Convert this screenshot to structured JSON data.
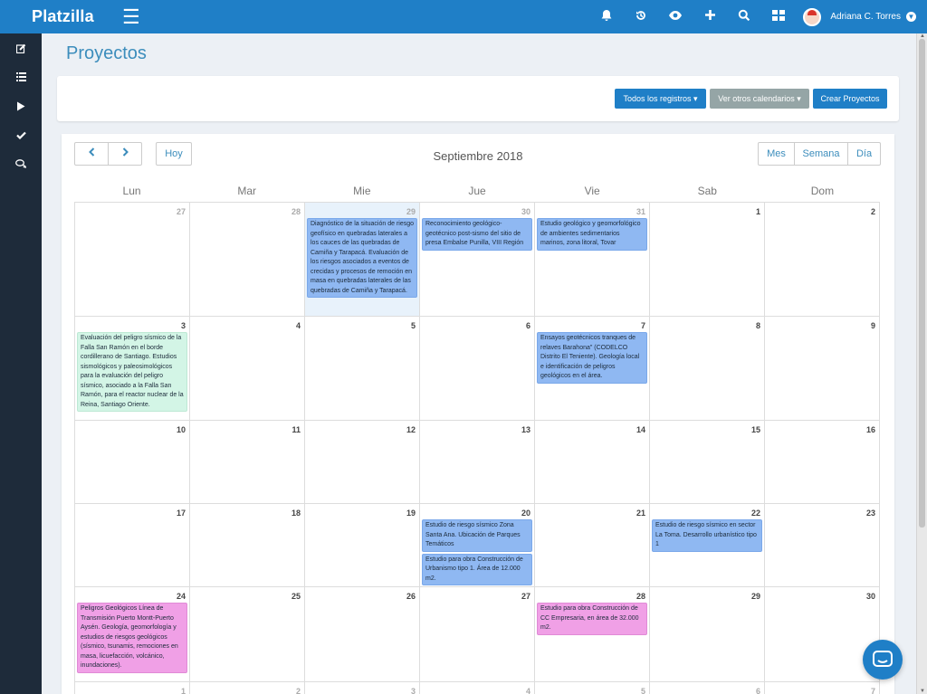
{
  "app": {
    "brand": "Platzilla"
  },
  "topbar": {
    "icons": [
      "bell-icon",
      "history-icon",
      "eye-icon",
      "plus-icon",
      "search-icon",
      "grid-icon"
    ],
    "user_name": "Adriana C. Torres"
  },
  "sidebar": {
    "items": [
      "edit-icon",
      "list-icon",
      "play-icon",
      "check-icon",
      "chat-icon"
    ]
  },
  "page": {
    "title": "Proyectos"
  },
  "toolbar": {
    "all_records": "Todos los registros ▾",
    "other_calendars": "Ver otros calendarios ▾",
    "create": "Crear Proyectos"
  },
  "colors": {
    "primary": "#1f7fc7",
    "sidebar": "#1e2b3a",
    "event_blue": "#8fb8f2",
    "event_green": "#d3f5e6",
    "event_pink": "#f0a0e6"
  },
  "calendar": {
    "title": "Septiembre 2018",
    "prev": "‹",
    "next": "›",
    "today_btn": "Hoy",
    "views": [
      "Mes",
      "Semana",
      "Día"
    ],
    "weekdays": [
      "Lun",
      "Mar",
      "Mie",
      "Jue",
      "Vie",
      "Sab",
      "Dom"
    ],
    "weeks": [
      [
        {
          "day": "27",
          "other": true,
          "events": []
        },
        {
          "day": "28",
          "other": true,
          "events": []
        },
        {
          "day": "29",
          "other": true,
          "today": true,
          "events": [
            {
              "color": "blue",
              "text": "Diagnóstico de la situación de riesgo geofísico en quebradas laterales a los cauces de las quebradas de Camiña y Tarapacá. Evaluación de los riesgos asociados a eventos de crecidas y procesos de remoción en masa en quebradas laterales de las quebradas de Camiña y Tarapacá."
            }
          ]
        },
        {
          "day": "30",
          "other": true,
          "events": [
            {
              "color": "blue",
              "text": "Reconocimiento geológico-geotécnico post-sismo del sitio de presa Embalse Punilla, VIII Región"
            }
          ]
        },
        {
          "day": "31",
          "other": true,
          "events": [
            {
              "color": "blue",
              "text": "Estudio geológico y geomorfológico de ambientes sedimentarios marinos, zona litoral, Tovar"
            }
          ]
        },
        {
          "day": "1",
          "events": []
        },
        {
          "day": "2",
          "events": []
        }
      ],
      [
        {
          "day": "3",
          "events": [
            {
              "color": "green",
              "text": "Evaluación del peligro sísmico de la Falla San Ramón en el borde cordillerano de Santiago. Estudios sismológicos y paleosimológicos para la evaluación del peligro sísmico, asociado a la Falla San Ramón, para el reactor nuclear de la Reina, Santiago Oriente."
            }
          ]
        },
        {
          "day": "4",
          "events": []
        },
        {
          "day": "5",
          "events": []
        },
        {
          "day": "6",
          "events": []
        },
        {
          "day": "7",
          "events": [
            {
              "color": "blue",
              "text": "Ensayos geotécnicos tranques de relaves Barahona\" (CODELCO Distrito El Teniente). Geología local e identificación de peligros geológicos en el área."
            }
          ]
        },
        {
          "day": "8",
          "events": []
        },
        {
          "day": "9",
          "events": []
        }
      ],
      [
        {
          "day": "10",
          "events": []
        },
        {
          "day": "11",
          "events": []
        },
        {
          "day": "12",
          "events": []
        },
        {
          "day": "13",
          "events": []
        },
        {
          "day": "14",
          "events": []
        },
        {
          "day": "15",
          "events": []
        },
        {
          "day": "16",
          "events": []
        }
      ],
      [
        {
          "day": "17",
          "events": []
        },
        {
          "day": "18",
          "events": []
        },
        {
          "day": "19",
          "events": []
        },
        {
          "day": "20",
          "events": [
            {
              "color": "blue",
              "text": "Estudio de riesgo sísmico Zona Santa Ana. Ubicación de Parques Temáticos"
            },
            {
              "color": "blue",
              "text": "Estudio para obra Construcción de Urbanismo tipo 1. Área de 12.000 m2."
            }
          ]
        },
        {
          "day": "21",
          "events": []
        },
        {
          "day": "22",
          "events": [
            {
              "color": "blue",
              "text": "Estudio de riesgo sísmico en sector La Toma. Desarrollo urbanístico tipo 1"
            }
          ]
        },
        {
          "day": "23",
          "events": []
        }
      ],
      [
        {
          "day": "24",
          "events": [
            {
              "color": "pink",
              "text": "Peligros Geológicos Línea de Transmisión Puerto Montt-Puerto Aysén. Geología, geomorfología y estudios de riesgos geológicos (sísmico, tsunamis, remociones en masa, licuefacción, volcánico, inundaciones)."
            }
          ]
        },
        {
          "day": "25",
          "events": []
        },
        {
          "day": "26",
          "events": []
        },
        {
          "day": "27",
          "events": []
        },
        {
          "day": "28",
          "events": [
            {
              "color": "pink",
              "text": "Estudio para obra Construcción de CC Empresaria, en área de 32.000 m2."
            }
          ]
        },
        {
          "day": "29",
          "events": []
        },
        {
          "day": "30",
          "events": []
        }
      ],
      [
        {
          "day": "1",
          "other": true,
          "events": []
        },
        {
          "day": "2",
          "other": true,
          "events": []
        },
        {
          "day": "3",
          "other": true,
          "events": []
        },
        {
          "day": "4",
          "other": true,
          "events": []
        },
        {
          "day": "5",
          "other": true,
          "events": []
        },
        {
          "day": "6",
          "other": true,
          "events": []
        },
        {
          "day": "7",
          "other": true,
          "events": []
        }
      ]
    ]
  }
}
